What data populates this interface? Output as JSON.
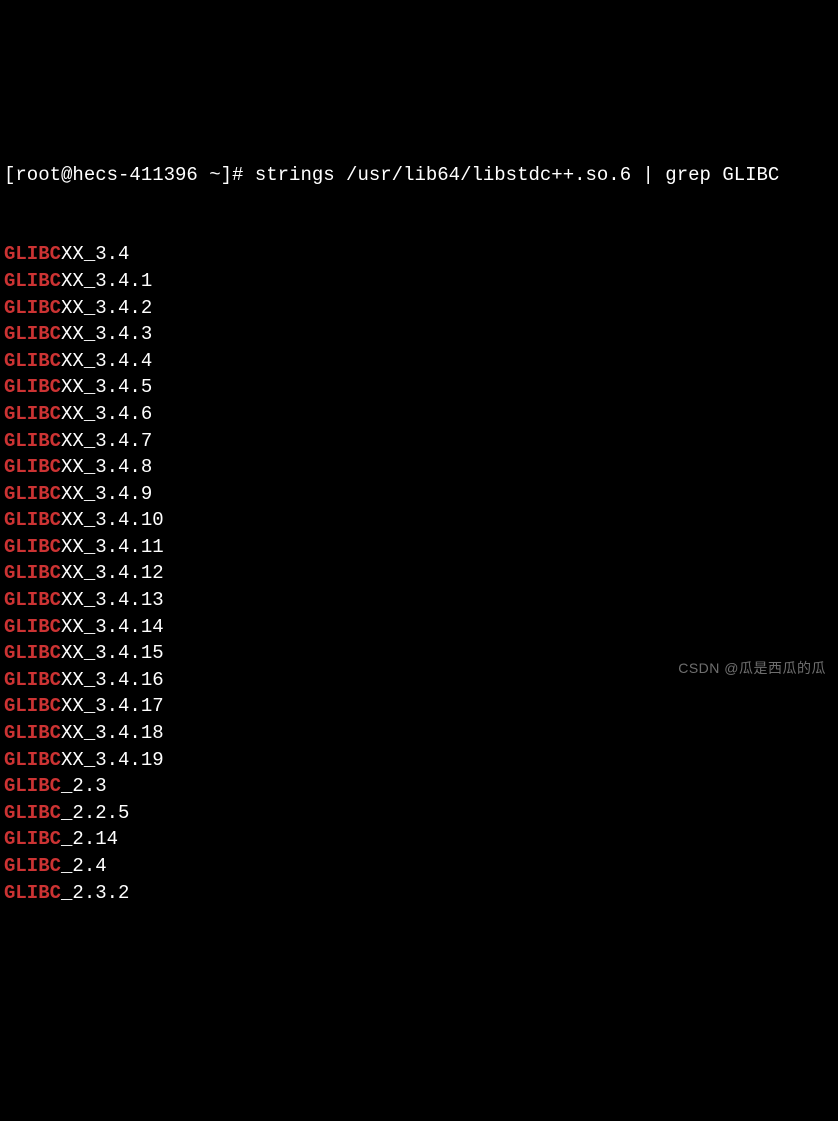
{
  "prompt": {
    "prefix": "[root@hecs-411396 ~]# ",
    "command": "strings /usr/lib64/libstdc++.so.6 | grep GLIBC"
  },
  "lines": [
    {
      "hl": "GLIBC",
      "rest": "XX_3.4"
    },
    {
      "hl": "GLIBC",
      "rest": "XX_3.4.1"
    },
    {
      "hl": "GLIBC",
      "rest": "XX_3.4.2"
    },
    {
      "hl": "GLIBC",
      "rest": "XX_3.4.3"
    },
    {
      "hl": "GLIBC",
      "rest": "XX_3.4.4"
    },
    {
      "hl": "GLIBC",
      "rest": "XX_3.4.5"
    },
    {
      "hl": "GLIBC",
      "rest": "XX_3.4.6"
    },
    {
      "hl": "GLIBC",
      "rest": "XX_3.4.7"
    },
    {
      "hl": "GLIBC",
      "rest": "XX_3.4.8"
    },
    {
      "hl": "GLIBC",
      "rest": "XX_3.4.9"
    },
    {
      "hl": "GLIBC",
      "rest": "XX_3.4.10"
    },
    {
      "hl": "GLIBC",
      "rest": "XX_3.4.11"
    },
    {
      "hl": "GLIBC",
      "rest": "XX_3.4.12"
    },
    {
      "hl": "GLIBC",
      "rest": "XX_3.4.13"
    },
    {
      "hl": "GLIBC",
      "rest": "XX_3.4.14"
    },
    {
      "hl": "GLIBC",
      "rest": "XX_3.4.15"
    },
    {
      "hl": "GLIBC",
      "rest": "XX_3.4.16"
    },
    {
      "hl": "GLIBC",
      "rest": "XX_3.4.17"
    },
    {
      "hl": "GLIBC",
      "rest": "XX_3.4.18"
    },
    {
      "hl": "GLIBC",
      "rest": "XX_3.4.19"
    },
    {
      "hl": "GLIBC",
      "rest": "_2.3"
    },
    {
      "hl": "GLIBC",
      "rest": "_2.2.5"
    },
    {
      "hl": "GLIBC",
      "rest": "_2.14"
    },
    {
      "hl": "GLIBC",
      "rest": "_2.4"
    },
    {
      "hl": "GLIBC",
      "rest": "_2.3.2"
    }
  ],
  "watermark": "CSDN @瓜是西瓜的瓜"
}
